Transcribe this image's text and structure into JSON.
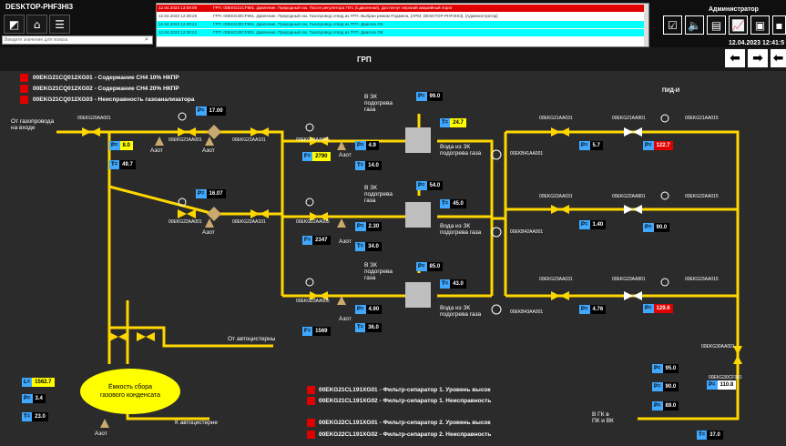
{
  "topbar": {
    "hostname": "DESKTOP-PHF3HI3",
    "search_placeholder": "Введите значение для поиска"
  },
  "alarms": [
    {
      "time": "12.04.2023 13:09:00",
      "msg": "ГРП. 00EKG21CF901. Давление. Природный газ. После регулятора ПУ1 (Сдвоенная). Достигнут верхний аварийный порог",
      "bg": "#e00000",
      "fg": "#ffffff"
    },
    {
      "time": "12.04.2023 12:38:26",
      "msg": "ГРП. 00EKG30CF901. Давление. Природный газ. Газопровод отвод из ГРП. Выбран режим Подмена. [АРМ: DESKTOP-PHF3HI3]. [Администратор]",
      "bg": "#ffffff",
      "fg": "#333333"
    },
    {
      "time": "12.04.2023 12:38:22",
      "msg": "ГРП. 00EKG30CF901. Давление. Природный газ. Газопровод отвод из ГРП. Диагноз ОК",
      "bg": "#00ffff",
      "fg": "#333333"
    },
    {
      "time": "12.04.2023 12:38:22",
      "msg": "ГРП. 00EKG30CF901. Давление. Природный газ. Газопровод отвод из ГРП. Диагноз ОК",
      "bg": "#00ffff",
      "fg": "#333333"
    }
  ],
  "admin": {
    "label": "Администратор",
    "datetime": "12.04.2023 12:41:5"
  },
  "screen_title": "ГРП",
  "pid_label": "ПИД-И",
  "gas_alarms": [
    "00EKG21CQ012XG01 - Содержание CH4 10% НКПР",
    "00EKG21CQ012XG02 - Содержание CH4 20% НКПР",
    "00EKG21CQ012XG03 - Неисправность газоанализатора"
  ],
  "filter_alarms": [
    "00EKG21CL191XG01 - Фильтр-сепаратор 1. Уровень высок",
    "00EKG21CL191XG02 - Фильтр-сепаратор 1. Неисправность",
    "00EKG22CL191XG01 - Фильтр-сепаратор 2. Уровень высок",
    "00EKG22CL191XG02 - Фильтр-сепаратор 2. Неисправность"
  ],
  "labels": {
    "inlet": "От газопровода\nна входе",
    "azot": "Азот",
    "heat_in": "В ЗК\nподогрева\nгаза",
    "heat_out": "Вода из ЗК\nподогрева газа",
    "from_truck": "От автоцистерны",
    "to_truck": "К автоцистерне",
    "to_boiler": "В ГК в\nПК и ВК",
    "tank": "Ёмкость сбора\nгазового конденсата",
    "tags": [
      "00EKG20AA001",
      "00EKG21AA001",
      "00EKG21AA101",
      "00EKG21AA005",
      "00EKG22AA001",
      "00EKG22AA101",
      "00EKG22AA005",
      "00EKG23AA005",
      "00EKB41AA001",
      "00EKB42AA001",
      "00EKB43AA001",
      "00EKG21AA031",
      "00EKG21AA801",
      "00EKG21AA015",
      "00EKG22AA031",
      "00EKG22AA801",
      "00EKG22AA015",
      "00EKG23AA031",
      "00EKG23AA801",
      "00EKG23AA015",
      "00EKG30AA001",
      "00EKG30CF901"
    ]
  },
  "values": {
    "p_inlet": {
      "k": "P=",
      "v": "8.0"
    },
    "t_inlet": {
      "k": "T=",
      "v": "49.7"
    },
    "p1_top": {
      "k": "P=",
      "v": "17.00"
    },
    "p2_top": {
      "k": "P=",
      "v": "16.07"
    },
    "l1_p": {
      "k": "P=",
      "v": "4.9"
    },
    "l1_f": {
      "k": "F=",
      "v": "2790"
    },
    "l1_t": {
      "k": "T=",
      "v": "14.0"
    },
    "l2_p": {
      "k": "P=",
      "v": "2.30"
    },
    "l2_f": {
      "k": "F=",
      "v": "2347"
    },
    "l2_t": {
      "k": "T=",
      "v": "34.0"
    },
    "l3_p": {
      "k": "P=",
      "v": "4.90"
    },
    "l3_f": {
      "k": "F=",
      "v": "1569"
    },
    "l3_t": {
      "k": "T=",
      "v": "36.0"
    },
    "hx1_p": {
      "k": "P=",
      "v": "99.0"
    },
    "hx1_t": {
      "k": "T=",
      "v": "24.7"
    },
    "hx2_p": {
      "k": "P=",
      "v": "54.0"
    },
    "hx2_t": {
      "k": "T=",
      "v": "45.0"
    },
    "hx3_p": {
      "k": "P=",
      "v": "85.0"
    },
    "hx3_t": {
      "k": "T=",
      "v": "43.0"
    },
    "r1_p": {
      "k": "P=",
      "v": "5.7"
    },
    "r1_p2": {
      "k": "P=",
      "v": "122.7"
    },
    "r2_p": {
      "k": "P=",
      "v": "1.40"
    },
    "r2_p2": {
      "k": "P=",
      "v": "90.0"
    },
    "r3_p": {
      "k": "P=",
      "v": "4.76"
    },
    "r3_p2": {
      "k": "P=",
      "v": "129.6"
    },
    "out_a": {
      "k": "P=",
      "v": "95.0"
    },
    "out_b": {
      "k": "P=",
      "v": "90.0"
    },
    "out_c": {
      "k": "P=",
      "v": "89.0"
    },
    "out_main": {
      "k": "P=",
      "v": "110.8"
    },
    "out_t": {
      "k": "T=",
      "v": "37.0"
    },
    "tank_l": {
      "k": "L=",
      "v": "1562.7"
    },
    "tank_p": {
      "k": "P=",
      "v": "3.4"
    },
    "tank_t": {
      "k": "T=",
      "v": "23.0"
    }
  },
  "colors": {
    "pipe": "#ffd700",
    "alarm": "#e00000",
    "value_key": "#40a9ff"
  }
}
